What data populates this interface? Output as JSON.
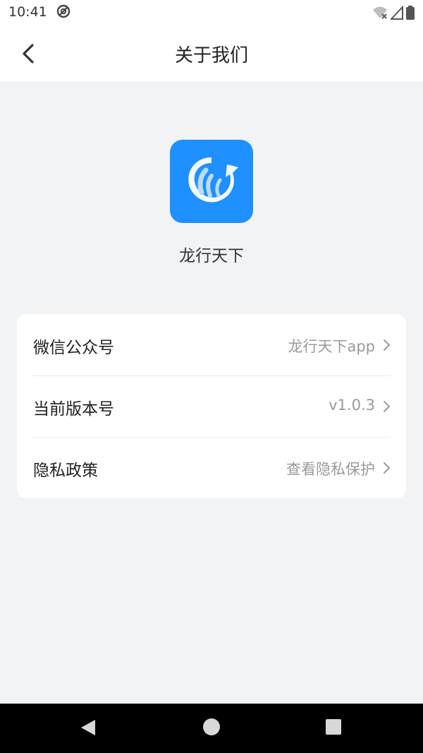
{
  "status_bar": {
    "time": "10:41",
    "icons": [
      "at-sign-icon",
      "wifi-off-icon",
      "signal-icon",
      "battery-icon"
    ]
  },
  "header": {
    "title": "关于我们",
    "back_icon": "chevron-left-icon"
  },
  "app": {
    "name": "龙行天下",
    "logo_color": "#1e90ff"
  },
  "settings": {
    "rows": [
      {
        "label": "微信公众号",
        "value": "龙行天下app"
      },
      {
        "label": "当前版本号",
        "value": "v1.0.3"
      },
      {
        "label": "隐私政策",
        "value": "查看隐私保护"
      }
    ]
  },
  "nav_bar": {
    "buttons": [
      "back-triangle-icon",
      "home-circle-icon",
      "recents-square-icon"
    ]
  }
}
